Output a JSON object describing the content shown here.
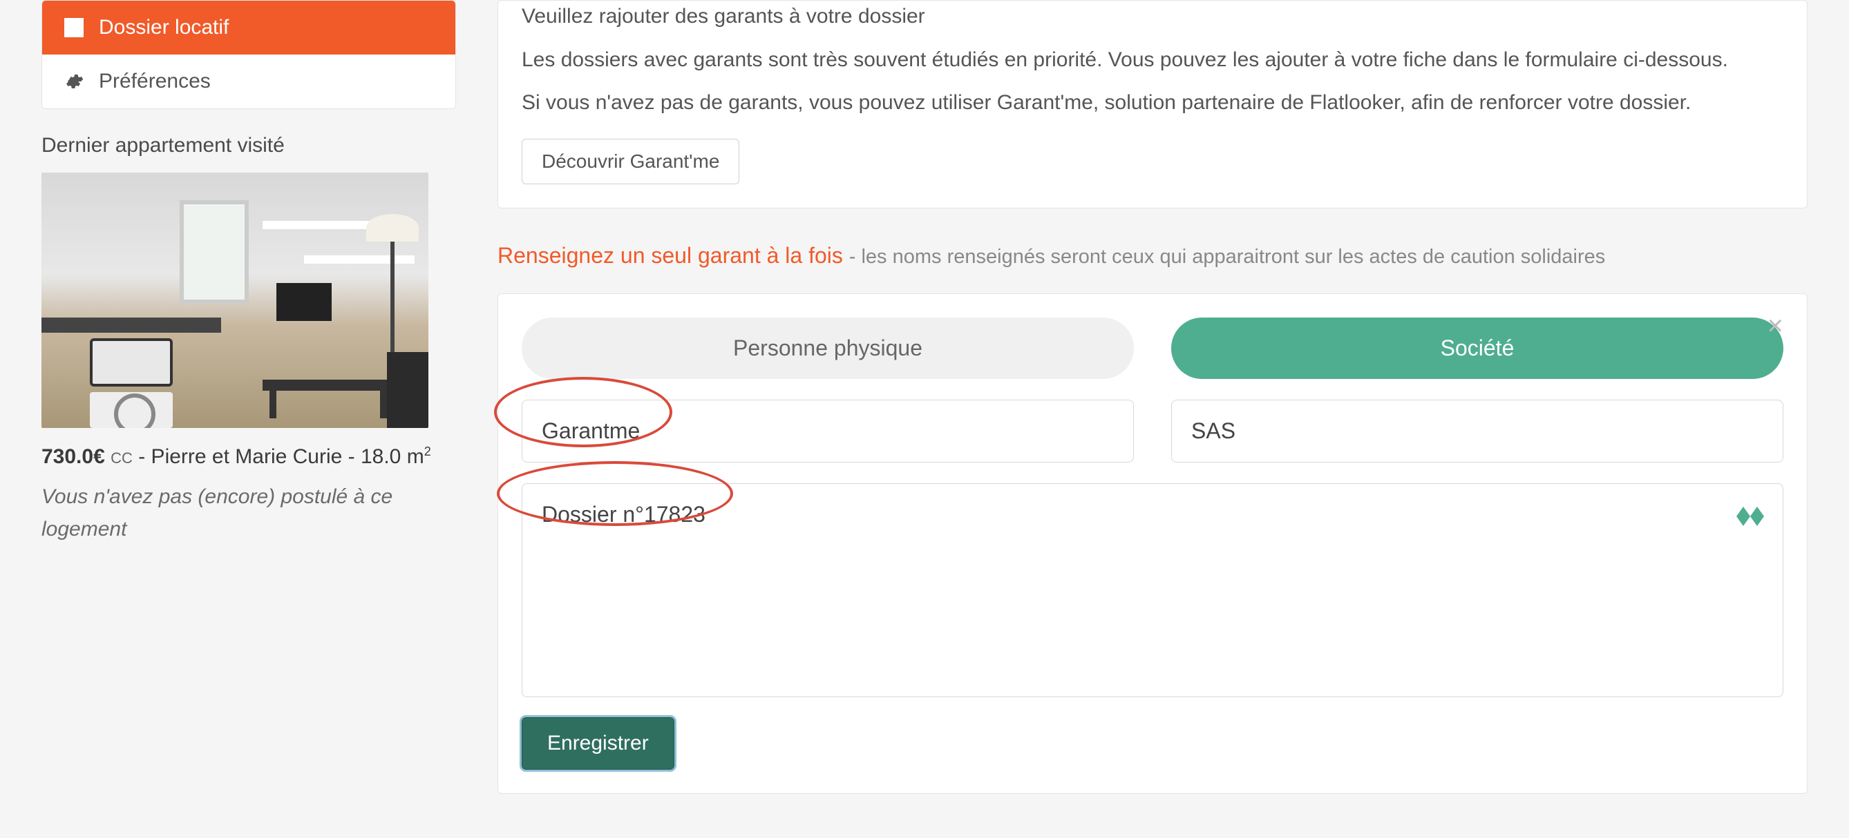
{
  "sidebar": {
    "nav": {
      "dossier_label": "Dossier locatif",
      "preferences_label": "Préférences"
    },
    "last_visited_title": "Dernier appartement visité",
    "apartment": {
      "price": "730.0€",
      "cc": "CC",
      "name_line": " - Pierre et Marie Curie - 18.0 m",
      "sup": "2",
      "note": "Vous n'avez pas (encore) postulé à ce logement"
    }
  },
  "main": {
    "notice": {
      "line1": "Veuillez rajouter des garants à votre dossier",
      "line2": "Les dossiers avec garants sont très souvent étudiés en priorité. Vous pouvez les ajouter à votre fiche dans le formulaire ci-dessous.",
      "line3": "Si vous n'avez pas de garants, vous pouvez utiliser Garant'me, solution partenaire de Flatlooker, afin de renforcer votre dossier.",
      "discover_btn": "Découvrir Garant'me"
    },
    "section": {
      "title": "Renseignez un seul garant à la fois",
      "subtitle": " - les noms renseignés seront ceux qui apparaitront sur les actes de caution solidaires"
    },
    "form": {
      "tabs": {
        "personne": "Personne physique",
        "societe": "Société"
      },
      "fields": {
        "company_name": "Garantme",
        "company_type": "SAS",
        "message": "Dossier n°17823"
      },
      "save_btn": "Enregistrer"
    }
  }
}
